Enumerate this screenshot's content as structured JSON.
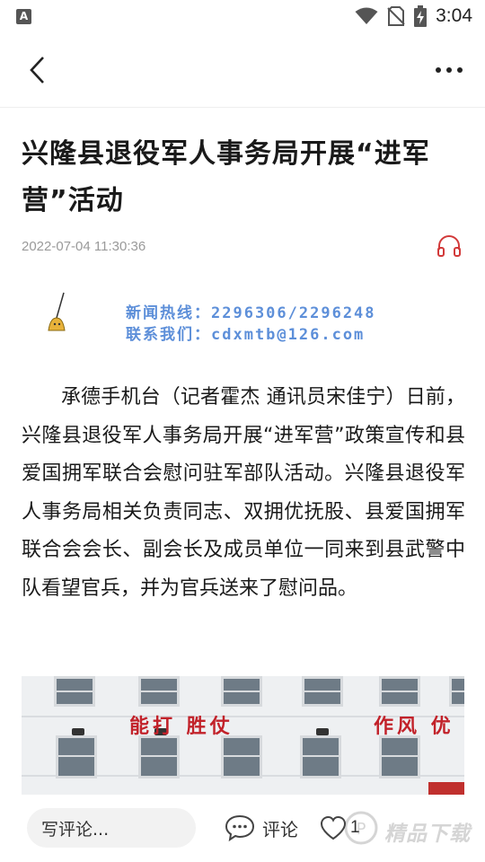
{
  "status_bar": {
    "left_icon_letter": "A",
    "time": "3:04",
    "icons": [
      "wifi-icon",
      "no-sim-icon",
      "battery-charging-icon"
    ]
  },
  "nav": {
    "back_icon": "chevron-left-icon",
    "more_icon": "more-horizontal-icon"
  },
  "article": {
    "title": "兴隆县退役军人事务局开展“进军营”活动",
    "date": "2022-07-04 11:30:36",
    "audio_icon": "headphones-icon",
    "banner": {
      "hotline": "新闻热线：2296306/2296248",
      "contact": "联系我们：cdxmtb@126.com"
    },
    "body": "承德手机台（记者霍杰 通讯员宋佳宁）日前，兴隆县退役军人事务局开展“进军营”政策宣传和县爱国拥军联合会慰问驻军部队活动。兴隆县退役军人事务局相关负责同志、双拥优抚股、县爱国拥军联合会会长、副会长及成员单位一同来到县武警中队看望官兵，并为官兵送来了慰问品。",
    "photo": {
      "slogan_left": "能打 胜仗",
      "slogan_right": "作风 优"
    }
  },
  "bottom_bar": {
    "comment_placeholder": "写评论...",
    "comment_label": "评论",
    "like_count": "1",
    "accent_color": "#c2222a",
    "watermark_text": "精品下载"
  }
}
